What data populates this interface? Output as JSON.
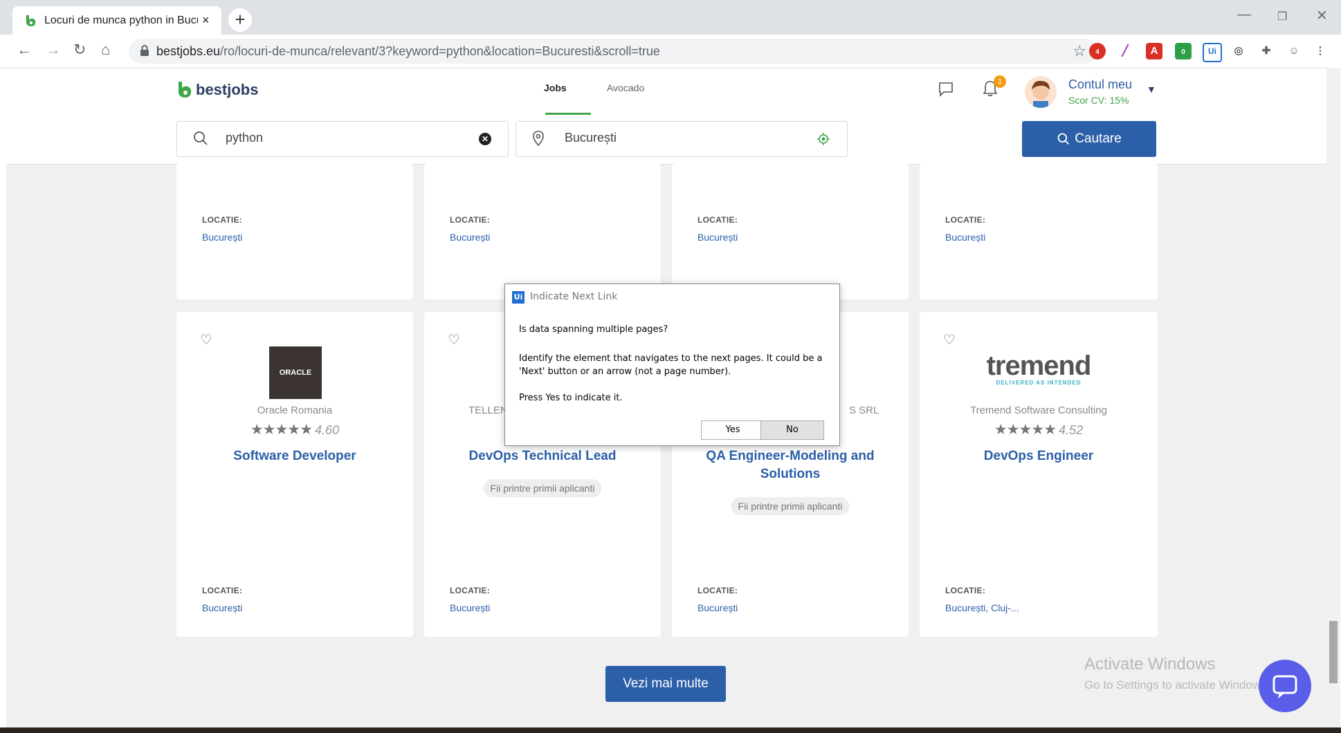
{
  "browser": {
    "tab_title": "Locuri de munca python in Bucur",
    "tab_close": "×",
    "new_tab": "+",
    "url_host": "bestjobs.eu",
    "url_path": "/ro/locuri-de-munca/relevant/3?keyword=python&location=Bucuresti&scroll=true",
    "ext_badge_1": "4",
    "ext_badge_2": "0",
    "ext_ui": "Ui"
  },
  "header": {
    "logo_text": "bestjobs",
    "nav_jobs": "Jobs",
    "nav_avocado": "Avocado",
    "notification_count": "1",
    "account_name": "Contul meu",
    "account_score": "Scor CV: 15%"
  },
  "search": {
    "keyword_value": "python",
    "location_value": "București",
    "button_label": "Cautare"
  },
  "top_cards": [
    {
      "location_label": "LOCATIE:",
      "location": "București"
    },
    {
      "location_label": "LOCATIE:",
      "location": "București"
    },
    {
      "location_label": "LOCATIE:",
      "location": "București"
    },
    {
      "location_label": "LOCATIE:",
      "location": "București"
    }
  ],
  "cards": [
    {
      "company": "Oracle Romania",
      "logo_text": "ORACLE",
      "rating": "4.60",
      "title": "Software Developer",
      "location_label": "LOCATIE:",
      "location": "București"
    },
    {
      "company": "TELLEN",
      "rating": "",
      "title": "DevOps Technical Lead",
      "badge": "Fii printre primii aplicanti",
      "location_label": "LOCATIE:",
      "location": "București"
    },
    {
      "company": "S SRL",
      "rating": "",
      "title": "QA Engineer-Modeling and Solutions",
      "badge": "Fii printre primii aplicanti",
      "location_label": "LOCATIE:",
      "location": "București"
    },
    {
      "company": "Tremend Software Consulting",
      "logo_text": "tremend",
      "logo_tagline": "DELIVERED AS INTENDED",
      "rating": "4.52",
      "title": "DevOps Engineer",
      "location_label": "LOCATIE:",
      "location": "București, Cluj-..."
    }
  ],
  "stars": "★★★★★",
  "more_button": "Vezi mai multe",
  "watermark": {
    "line1": "Activate Windows",
    "line2": "Go to Settings to activate Windows."
  },
  "dialog": {
    "icon": "Ui",
    "title": "Indicate Next Link",
    "question": "Is data spanning multiple pages?",
    "description": "Identify the element that navigates to the next pages. It could be a 'Next' button or an arrow (not a page number).",
    "press": "Press Yes to indicate it.",
    "yes": "Yes",
    "no": "No"
  },
  "colors": {
    "brand_blue": "#2b5fa8",
    "brand_green": "#3fa548",
    "badge_orange": "#f39c12"
  }
}
